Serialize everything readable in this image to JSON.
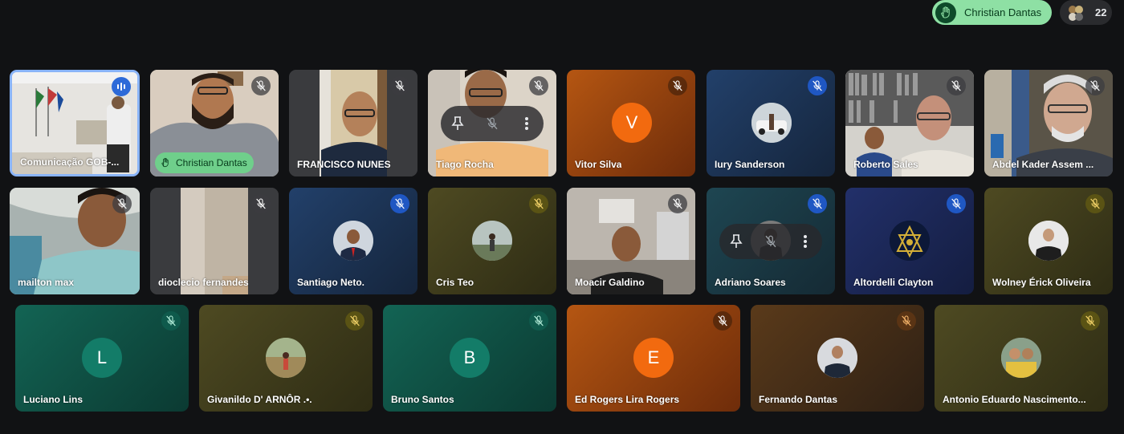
{
  "top_bar": {
    "raised_hand_name": "Christian Dantas",
    "participant_count": "22"
  },
  "row1": [
    {
      "name": "Comunicação GOB-...",
      "icon": "speaking-icon"
    },
    {
      "name": "",
      "icon": "mic-off-icon",
      "chip": "Christian Dantas"
    },
    {
      "name": "FRANCISCO NUNES",
      "icon": "mic-off-icon"
    },
    {
      "name": "Tiago Rocha",
      "icon": "mic-off-icon"
    },
    {
      "name": "Vitor Silva",
      "icon": "mic-off-icon",
      "initial": "V"
    },
    {
      "name": "Iury Sanderson",
      "icon": "mic-off-icon"
    },
    {
      "name": "Roberto Sales",
      "icon": "mic-off-icon"
    },
    {
      "name": "Abdel Kader Assem ...",
      "icon": "mic-off-icon"
    }
  ],
  "row2": [
    {
      "name": "mailton max",
      "icon": "mic-off-icon"
    },
    {
      "name": "dioclecio fernandes",
      "icon": "mic-off-icon"
    },
    {
      "name": "Santiago Neto.",
      "icon": "mic-off-icon"
    },
    {
      "name": "Cris Teo",
      "icon": "mic-off-icon"
    },
    {
      "name": "Moacir Galdino",
      "icon": "mic-off-icon"
    },
    {
      "name": "Adriano Soares",
      "icon": "mic-off-icon"
    },
    {
      "name": "Altordelli Clayton",
      "icon": "mic-off-icon"
    },
    {
      "name": "Wolney Érick Oliveira",
      "icon": "mic-off-icon"
    }
  ],
  "row3": [
    {
      "name": "Luciano Lins",
      "icon": "mic-off-icon",
      "initial": "L"
    },
    {
      "name": "Givanildo D' ARNÔR .•.",
      "icon": "mic-off-icon"
    },
    {
      "name": "Bruno Santos",
      "icon": "mic-off-icon",
      "initial": "B"
    },
    {
      "name": "Ed Rogers Lira Rogers",
      "icon": "mic-off-icon",
      "initial": "E"
    },
    {
      "name": "Fernando Dantas",
      "icon": "mic-off-icon"
    },
    {
      "name": "Antonio Eduardo Nascimento...",
      "icon": "mic-off-icon"
    }
  ],
  "colors": {
    "speaking_border": "#8ab4f8",
    "raised_hand_bg": "#8ee0a4",
    "tile_orange": "#a34a10",
    "tile_navy": "#1c3556",
    "tile_teal": "#0f5a4c",
    "tile_olive": "#4a4520",
    "avatar_orange": "#f26a0f",
    "avatar_teal": "#137c68"
  }
}
